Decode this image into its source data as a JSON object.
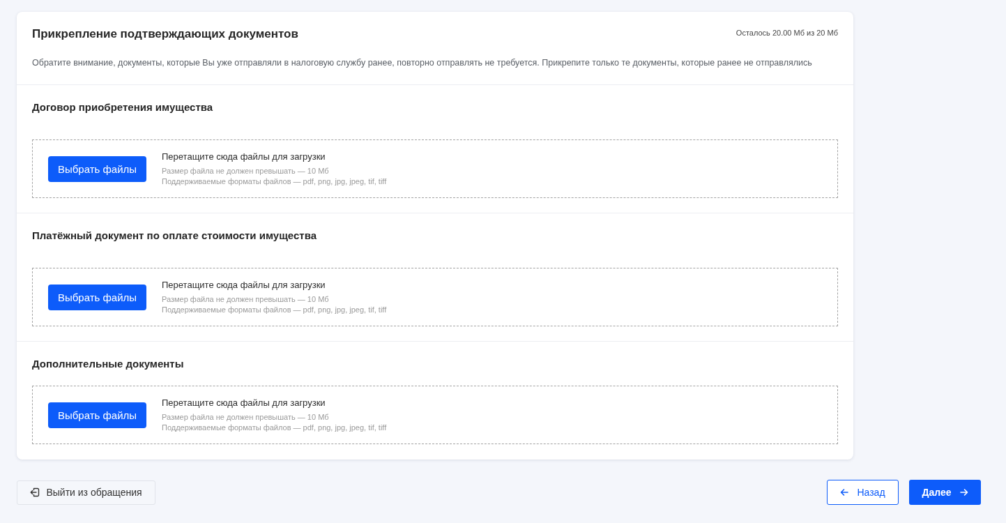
{
  "header": {
    "title": "Прикрепление подтверждающих документов",
    "quota": "Осталось 20.00 Мб из 20 Мб",
    "notice": "Обратите внимание, документы, которые Вы уже отправляли в налоговую службу ранее, повторно отправлять не требуется. Прикрепите только те документы, которые ранее не отправлялись"
  },
  "sections": [
    {
      "title": "Договор приобретения имущества",
      "upload": {
        "button": "Выбрать файлы",
        "hint": "Перетащите сюда файлы для загрузки",
        "size_note": "Размер файла не должен превышать — 10 Мб",
        "formats_note": "Поддерживаемые форматы файлов — pdf, png, jpg, jpeg, tif, tiff"
      }
    },
    {
      "title": "Платёжный документ по оплате стоимости имущества",
      "upload": {
        "button": "Выбрать файлы",
        "hint": "Перетащите сюда файлы для загрузки",
        "size_note": "Размер файла не должен превышать — 10 Мб",
        "formats_note": "Поддерживаемые форматы файлов — pdf, png, jpg, jpeg, tif, tiff"
      }
    },
    {
      "title": "Дополнительные документы",
      "upload": {
        "button": "Выбрать файлы",
        "hint": "Перетащите сюда файлы для загрузки",
        "size_note": "Размер файла не должен превышать — 10 Мб",
        "formats_note": "Поддерживаемые форматы файлов — pdf, png, jpg, jpeg, tif, tiff"
      }
    }
  ],
  "footer": {
    "exit_button": "Выйти из обращения",
    "back_button": "Назад",
    "next_button": "Далее"
  }
}
